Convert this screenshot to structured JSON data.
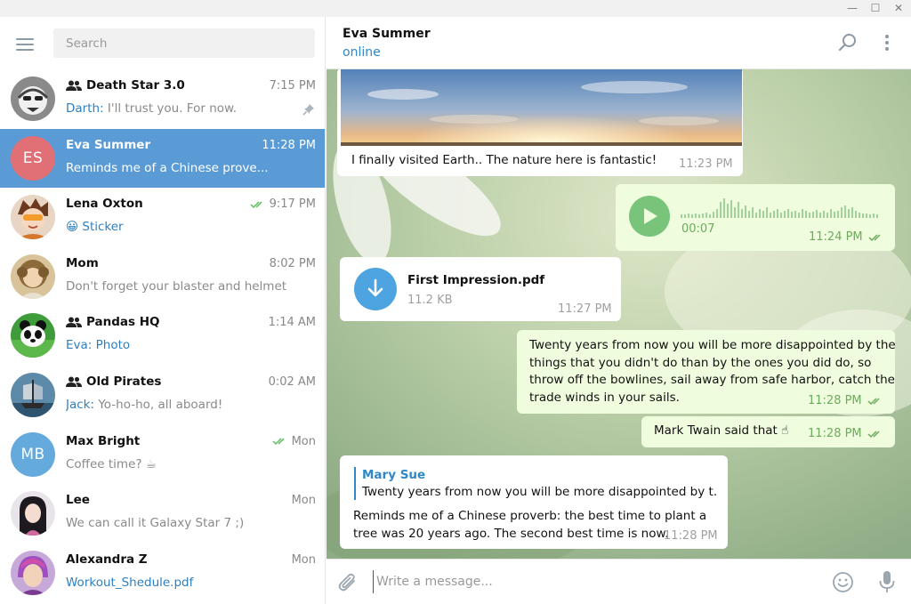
{
  "window": {
    "minimize_glyph": "—",
    "maximize_glyph": "☐",
    "close_glyph": "✕"
  },
  "sidebar": {
    "search_placeholder": "Search",
    "dialogs": [
      {
        "name": "Death Star 3.0",
        "group": true,
        "time": "7:15 PM",
        "sender": "Darth:",
        "text": " I'll trust you. For now.",
        "pinned": true,
        "avatar_icon": "stormtrooper-avatar"
      },
      {
        "name": "Eva Summer",
        "group": false,
        "time": "11:28 PM",
        "text": "Reminds me of a Chinese prove...",
        "initials": "ES",
        "avatar_color": "#e17076",
        "active": true
      },
      {
        "name": "Lena Oxton",
        "group": false,
        "time": "9:17 PM",
        "read": true,
        "emoji": "😀",
        "text": "Sticker",
        "avatar_icon": "tracer-avatar"
      },
      {
        "name": "Mom",
        "group": false,
        "time": "8:02 PM",
        "text": "Don't forget your blaster and helmet",
        "avatar_icon": "mom-avatar"
      },
      {
        "name": "Pandas HQ",
        "group": true,
        "time": "1:14 AM",
        "sender": "Eva:",
        "text": " Photo",
        "avatar_icon": "panda-avatar"
      },
      {
        "name": "Old Pirates",
        "group": true,
        "time": "0:02 AM",
        "sender": "Jack:",
        "text": " Yo-ho-ho, all aboard!",
        "avatar_icon": "ship-avatar"
      },
      {
        "name": "Max Bright",
        "group": false,
        "time": "Mon",
        "read": true,
        "text": "Coffee time? ☕",
        "initials": "MB",
        "avatar_color": "#65aadd"
      },
      {
        "name": "Lee",
        "group": false,
        "time": "Mon",
        "text": "We can call it Galaxy Star 7 ;)",
        "avatar_icon": "lee-avatar"
      },
      {
        "name": "Alexandra Z",
        "group": false,
        "time": "Mon",
        "text": "Workout_Shedule.pdf",
        "avatar_icon": "alexandra-avatar"
      }
    ]
  },
  "chat": {
    "peer_name": "Eva Summer",
    "peer_status": "online",
    "messages": {
      "photo_caption": "I finally visited Earth.. The nature here is fantastic!",
      "photo_time": "11:23 PM",
      "voice_duration": "00:07",
      "voice_time": "11:24 PM",
      "file_name": "First Impression.pdf",
      "file_size": "11.2 KB",
      "file_time": "11:27 PM",
      "quote_lines": [
        "Twenty years from now you will be more disappointed by the",
        "things that you didn't do than by the ones you did do, so",
        "throw off the bowlines, sail away from safe harbor, catch the",
        "trade winds in your sails."
      ],
      "quote_time": "11:28 PM",
      "twain_text": "Mark Twain said that ☝",
      "twain_time": "11:28 PM",
      "reply_author": "Mary Sue",
      "reply_snippet": "Twenty years from now you will be more disappointed by t...",
      "reply_lines": [
        "Reminds me of a Chinese proverb: the best time to plant a",
        "tree was 20 years ago. The second best time is now."
      ],
      "reply_time": "11:28 PM"
    }
  },
  "composer": {
    "placeholder": "Write a message..."
  },
  "colors": {
    "accent": "#5a9bd5",
    "link": "#2f7fc0",
    "outgoing_bubble": "#effdde",
    "read_check": "#5cbf5c",
    "voice_play": "#78c47a"
  }
}
